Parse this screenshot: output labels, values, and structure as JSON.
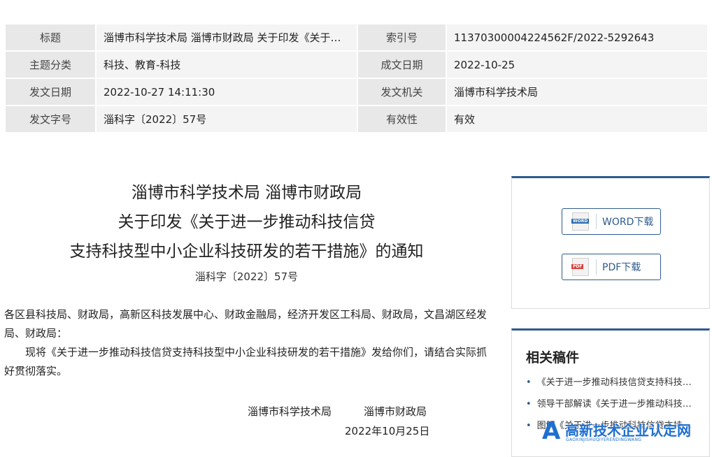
{
  "meta": {
    "rows": [
      {
        "label1": "标题",
        "value1": "淄博市科学技术局 淄博市财政局 关于印发《关于进一步推动科技信贷支持科技型中小企业科技研发的若干措施》的通知",
        "label2": "索引号",
        "value2": "11370300004224562F/2022-5292643"
      },
      {
        "label1": "主题分类",
        "value1": "科技、教育-科技",
        "label2": "成文日期",
        "value2": "2022-10-25"
      },
      {
        "label1": "发文日期",
        "value1": "2022-10-27 14:11:30",
        "label2": "发文机关",
        "value2": "淄博市科学技术局"
      },
      {
        "label1": "发文字号",
        "value1": "淄科字〔2022〕57号",
        "label2": "有效性",
        "value2": "有效"
      }
    ]
  },
  "article": {
    "title_lines": [
      "淄博市科学技术局  淄博市财政局",
      "关于印发《关于进一步推动科技信贷",
      "支持科技型中小企业科技研发的若干措施》的通知"
    ],
    "doc_number": "淄科字〔2022〕57号",
    "recipients": "各区县科技局、财政局，高新区科技发展中心、财政金融局，经济开发区工科局、财政局，文昌湖区经发局、财政局：",
    "body": "现将《关于进一步推动科技信贷支持科技型中小企业科技研发的若干措施》发给你们，请结合实际抓好贯彻落实。",
    "signers": [
      "淄博市科学技术局",
      "淄博市财政局"
    ],
    "date": "2022年10月25日"
  },
  "downloads": {
    "word_label": "WORD下载",
    "pdf_label": "PDF下载",
    "word_icon": "word-file-icon",
    "pdf_icon": "pdf-file-icon"
  },
  "related": {
    "heading": "相关稿件",
    "items": [
      "《关于进一步推动科技信贷支持科技型中小企业科技研发的若干措施》",
      "领导干部解读《关于进一步推动科技信贷支持科技型中小企业科技研发的若干措施》",
      "图解《关于进一步推动科技信贷支持科技型中小企业科技研发的若干措施》"
    ]
  },
  "watermark": {
    "logo_letter": "A",
    "text": "高新技术企业认定网",
    "sub": "GAOXINJISHUQIYERENDINGWANG"
  },
  "colors": {
    "accent": "#2e5b8e",
    "watermark": "#1e6fd0",
    "label_bg": "#e8e8e8",
    "value_bg": "#f4f4f4"
  }
}
